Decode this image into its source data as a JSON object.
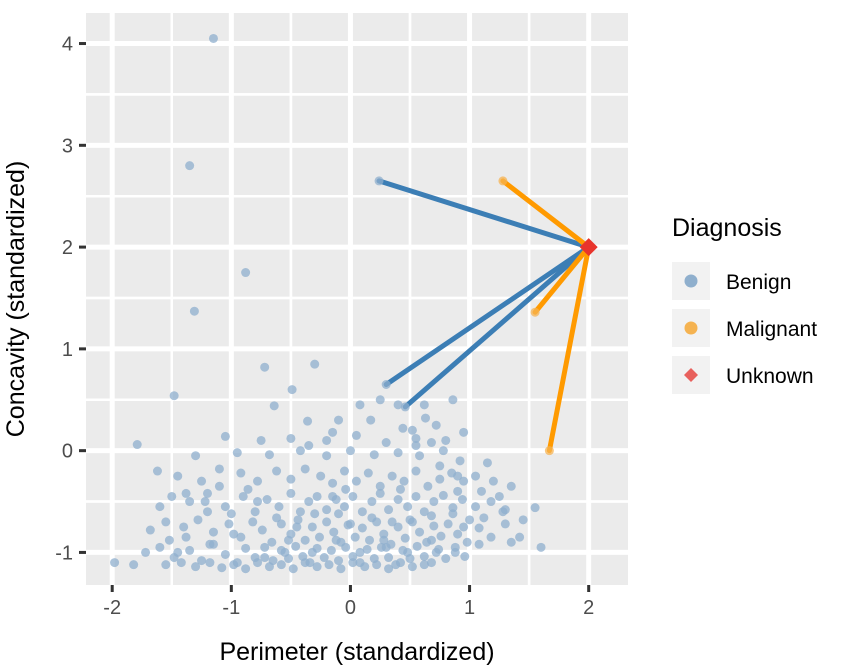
{
  "chart_data": {
    "type": "scatter",
    "title": "",
    "xlabel": "Perimeter (standardized)",
    "ylabel": "Concavity (standardized)",
    "xlim": [
      -2.22,
      2.33
    ],
    "ylim": [
      -1.32,
      4.3
    ],
    "xticks": [
      -2,
      -1,
      0,
      1,
      2
    ],
    "xticklabels": [
      "-2",
      "-1",
      "0",
      "1",
      "2"
    ],
    "yticks": [
      -1,
      0,
      1,
      2,
      3,
      4
    ],
    "yticklabels": [
      "-1",
      "0",
      "1",
      "2",
      "3",
      "4"
    ],
    "grid": true,
    "panel_background": "#EBEBEB",
    "grid_major_color": "#FFFFFF",
    "grid_minor_color": "#FFFFFF",
    "legend": {
      "title": "Diagnosis",
      "position": "right",
      "entries": [
        {
          "label": "Benign",
          "color": "#8FAFCD",
          "shape": "circle"
        },
        {
          "label": "Malignant",
          "color": "#F5B351",
          "shape": "circle"
        },
        {
          "label": "Unknown",
          "color": "#E8615D",
          "shape": "diamond"
        }
      ]
    },
    "series": [
      {
        "name": "Benign",
        "color": "#8FAFCD",
        "shape": "circle",
        "point_size": 9,
        "opacity": 0.75,
        "points": [
          [
            -1.15,
            4.05
          ],
          [
            -1.35,
            2.8
          ],
          [
            0.24,
            2.65
          ],
          [
            -0.88,
            1.75
          ],
          [
            -1.31,
            1.37
          ],
          [
            -0.3,
            0.85
          ],
          [
            -0.72,
            0.82
          ],
          [
            0.3,
            0.65
          ],
          [
            -1.48,
            0.54
          ],
          [
            -0.49,
            0.6
          ],
          [
            -0.64,
            0.44
          ],
          [
            0.46,
            0.43
          ],
          [
            0.62,
            0.45
          ],
          [
            0.86,
            0.5
          ],
          [
            0.63,
            0.32
          ],
          [
            -0.36,
            0.29
          ],
          [
            -0.1,
            0.3
          ],
          [
            0.17,
            0.3
          ],
          [
            0.44,
            0.22
          ],
          [
            0.72,
            0.25
          ],
          [
            -1.79,
            0.06
          ],
          [
            -1.05,
            0.14
          ],
          [
            -0.75,
            0.1
          ],
          [
            -0.5,
            0.12
          ],
          [
            -0.2,
            0.1
          ],
          [
            0.05,
            0.15
          ],
          [
            0.3,
            0.08
          ],
          [
            0.55,
            0.12
          ],
          [
            0.8,
            0.1
          ],
          [
            0.95,
            0.18
          ],
          [
            -1.3,
            -0.05
          ],
          [
            -0.95,
            -0.02
          ],
          [
            -0.68,
            -0.04
          ],
          [
            -0.42,
            0.0
          ],
          [
            -0.2,
            -0.05
          ],
          [
            0.0,
            0.0
          ],
          [
            0.2,
            -0.04
          ],
          [
            0.4,
            -0.02
          ],
          [
            0.58,
            -0.05
          ],
          [
            0.78,
            0.0
          ],
          [
            0.92,
            -0.1
          ],
          [
            1.15,
            -0.12
          ],
          [
            -1.62,
            -0.2
          ],
          [
            -1.45,
            -0.25
          ],
          [
            -1.25,
            -0.3
          ],
          [
            -1.1,
            -0.18
          ],
          [
            -0.92,
            -0.22
          ],
          [
            -0.78,
            -0.3
          ],
          [
            -0.62,
            -0.2
          ],
          [
            -0.5,
            -0.28
          ],
          [
            -0.38,
            -0.18
          ],
          [
            -0.25,
            -0.25
          ],
          [
            -0.15,
            -0.32
          ],
          [
            -0.05,
            -0.2
          ],
          [
            0.05,
            -0.3
          ],
          [
            0.15,
            -0.22
          ],
          [
            0.25,
            -0.35
          ],
          [
            0.35,
            -0.25
          ],
          [
            0.45,
            -0.3
          ],
          [
            0.55,
            -0.2
          ],
          [
            0.65,
            -0.35
          ],
          [
            0.75,
            -0.28
          ],
          [
            0.85,
            -0.22
          ],
          [
            0.95,
            -0.3
          ],
          [
            1.05,
            -0.25
          ],
          [
            1.2,
            -0.3
          ],
          [
            1.35,
            -0.35
          ],
          [
            -1.5,
            -0.45
          ],
          [
            -1.35,
            -0.5
          ],
          [
            -1.2,
            -0.42
          ],
          [
            -1.05,
            -0.55
          ],
          [
            -0.9,
            -0.45
          ],
          [
            -0.8,
            -0.6
          ],
          [
            -0.7,
            -0.48
          ],
          [
            -0.6,
            -0.55
          ],
          [
            -0.5,
            -0.42
          ],
          [
            -0.42,
            -0.6
          ],
          [
            -0.35,
            -0.5
          ],
          [
            -0.28,
            -0.45
          ],
          [
            -0.2,
            -0.58
          ],
          [
            -0.12,
            -0.48
          ],
          [
            -0.05,
            -0.55
          ],
          [
            0.02,
            -0.45
          ],
          [
            0.1,
            -0.6
          ],
          [
            0.18,
            -0.5
          ],
          [
            0.25,
            -0.42
          ],
          [
            0.32,
            -0.58
          ],
          [
            0.4,
            -0.48
          ],
          [
            0.48,
            -0.55
          ],
          [
            0.55,
            -0.45
          ],
          [
            0.62,
            -0.6
          ],
          [
            0.7,
            -0.5
          ],
          [
            0.78,
            -0.44
          ],
          [
            0.86,
            -0.56
          ],
          [
            0.94,
            -0.48
          ],
          [
            1.05,
            -0.55
          ],
          [
            1.18,
            -0.5
          ],
          [
            1.3,
            -0.58
          ],
          [
            1.55,
            -0.56
          ],
          [
            -1.55,
            -0.7
          ],
          [
            -1.4,
            -0.75
          ],
          [
            -1.28,
            -0.68
          ],
          [
            -1.15,
            -0.8
          ],
          [
            -1.02,
            -0.72
          ],
          [
            -0.92,
            -0.85
          ],
          [
            -0.82,
            -0.7
          ],
          [
            -0.74,
            -0.78
          ],
          [
            -0.66,
            -0.9
          ],
          [
            -0.58,
            -0.72
          ],
          [
            -0.5,
            -0.82
          ],
          [
            -0.44,
            -0.68
          ],
          [
            -0.38,
            -0.88
          ],
          [
            -0.32,
            -0.75
          ],
          [
            -0.26,
            -0.85
          ],
          [
            -0.2,
            -0.7
          ],
          [
            -0.14,
            -0.8
          ],
          [
            -0.08,
            -0.9
          ],
          [
            -0.02,
            -0.73
          ],
          [
            0.04,
            -0.85
          ],
          [
            0.1,
            -0.76
          ],
          [
            0.16,
            -0.88
          ],
          [
            0.22,
            -0.7
          ],
          [
            0.28,
            -0.82
          ],
          [
            0.34,
            -0.92
          ],
          [
            0.4,
            -0.75
          ],
          [
            0.46,
            -0.86
          ],
          [
            0.52,
            -0.7
          ],
          [
            0.58,
            -0.8
          ],
          [
            0.64,
            -0.9
          ],
          [
            0.7,
            -0.74
          ],
          [
            0.76,
            -0.84
          ],
          [
            0.82,
            -0.72
          ],
          [
            0.9,
            -0.82
          ],
          [
            0.98,
            -0.9
          ],
          [
            1.08,
            -0.76
          ],
          [
            1.18,
            -0.85
          ],
          [
            1.3,
            -0.72
          ],
          [
            -1.72,
            -1.0
          ],
          [
            -1.6,
            -0.95
          ],
          [
            -1.48,
            -1.05
          ],
          [
            -1.35,
            -0.98
          ],
          [
            -1.25,
            -1.08
          ],
          [
            -1.15,
            -0.92
          ],
          [
            -1.05,
            -1.02
          ],
          [
            -0.95,
            -1.1
          ],
          [
            -0.88,
            -0.96
          ],
          [
            -0.8,
            -1.05
          ],
          [
            -0.72,
            -0.95
          ],
          [
            -0.65,
            -1.08
          ],
          [
            -0.58,
            -0.98
          ],
          [
            -0.52,
            -1.06
          ],
          [
            -0.46,
            -0.94
          ],
          [
            -0.4,
            -1.04
          ],
          [
            -0.34,
            -1.1
          ],
          [
            -0.28,
            -0.96
          ],
          [
            -0.22,
            -1.05
          ],
          [
            -0.16,
            -0.98
          ],
          [
            -0.1,
            -1.08
          ],
          [
            -0.04,
            -0.95
          ],
          [
            0.02,
            -1.04
          ],
          [
            0.08,
            -1.1
          ],
          [
            0.14,
            -0.97
          ],
          [
            0.2,
            -1.06
          ],
          [
            0.26,
            -0.95
          ],
          [
            0.32,
            -1.05
          ],
          [
            0.38,
            -1.12
          ],
          [
            0.44,
            -0.98
          ],
          [
            0.5,
            -1.06
          ],
          [
            0.56,
            -0.94
          ],
          [
            0.62,
            -1.04
          ],
          [
            0.68,
            -1.1
          ],
          [
            0.74,
            -0.97
          ],
          [
            0.8,
            -1.06
          ],
          [
            0.88,
            -0.95
          ],
          [
            0.96,
            -1.04
          ],
          [
            -1.98,
            -1.1
          ],
          [
            -1.82,
            -1.12
          ],
          [
            -1.55,
            -1.12
          ],
          [
            -1.42,
            -1.1
          ],
          [
            -1.3,
            -1.14
          ],
          [
            -1.18,
            -1.1
          ],
          [
            -1.08,
            -1.15
          ],
          [
            -0.98,
            -1.12
          ],
          [
            -0.88,
            -1.16
          ],
          [
            -0.78,
            -1.1
          ],
          [
            -0.68,
            -1.14
          ],
          [
            -0.58,
            -1.12
          ],
          [
            -0.48,
            -1.16
          ],
          [
            -0.38,
            -1.1
          ],
          [
            -0.28,
            -1.14
          ],
          [
            -0.18,
            -1.12
          ],
          [
            -0.08,
            -1.16
          ],
          [
            0.02,
            -1.1
          ],
          [
            0.12,
            -1.14
          ],
          [
            0.22,
            -1.12
          ],
          [
            0.32,
            -1.16
          ],
          [
            0.42,
            -1.1
          ],
          [
            0.52,
            -1.14
          ],
          [
            0.62,
            -1.12
          ],
          [
            -1.1,
            -0.35
          ],
          [
            -1.0,
            -0.62
          ],
          [
            -0.86,
            -0.38
          ],
          [
            -0.62,
            -0.66
          ],
          [
            -0.3,
            -0.62
          ],
          [
            -0.04,
            -0.38
          ],
          [
            0.18,
            -0.66
          ],
          [
            0.42,
            -0.38
          ],
          [
            0.68,
            -0.64
          ],
          [
            0.9,
            -0.4
          ],
          [
            1.12,
            -0.66
          ],
          [
            1.35,
            -0.9
          ],
          [
            -1.38,
            -0.85
          ],
          [
            -1.2,
            -0.6
          ],
          [
            -0.55,
            -1.0
          ],
          [
            -0.1,
            -0.62
          ],
          [
            0.3,
            -0.95
          ],
          [
            0.72,
            -1.0
          ],
          [
            1.0,
            -0.68
          ],
          [
            -0.45,
            -0.75
          ],
          [
            0.0,
            -0.72
          ],
          [
            0.5,
            -0.68
          ],
          [
            0.95,
            -0.75
          ],
          [
            -0.78,
            -0.5
          ],
          [
            -0.15,
            -0.45
          ],
          [
            0.35,
            -0.7
          ],
          [
            0.86,
            -0.62
          ],
          [
            1.25,
            -0.45
          ],
          [
            1.45,
            -0.68
          ],
          [
            -1.6,
            -0.55
          ],
          [
            -1.45,
            -1.0
          ],
          [
            -1.18,
            -0.92
          ],
          [
            -0.98,
            -0.82
          ],
          [
            -0.72,
            -1.05
          ],
          [
            -0.52,
            -0.88
          ],
          [
            -0.32,
            -1.0
          ],
          [
            -0.12,
            -0.88
          ],
          [
            0.08,
            -1.0
          ],
          [
            0.28,
            -0.88
          ],
          [
            0.48,
            -1.0
          ],
          [
            0.68,
            -0.88
          ],
          [
            0.88,
            -1.0
          ],
          [
            1.08,
            -0.92
          ],
          [
            0.55,
            0.05
          ],
          [
            0.68,
            0.08
          ],
          [
            0.4,
            0.45
          ],
          [
            0.52,
            0.2
          ],
          [
            0.25,
            0.5
          ],
          [
            0.08,
            0.45
          ],
          [
            -0.15,
            0.18
          ],
          [
            -0.35,
            0.05
          ],
          [
            0.75,
            -0.15
          ],
          [
            0.9,
            -0.25
          ],
          [
            1.1,
            -0.4
          ],
          [
            1.28,
            -0.6
          ],
          [
            1.42,
            -0.85
          ],
          [
            1.6,
            -0.95
          ],
          [
            -1.68,
            -0.78
          ],
          [
            -1.52,
            -0.88
          ],
          [
            -1.38,
            -0.42
          ],
          [
            -1.22,
            -0.5
          ]
        ]
      },
      {
        "name": "Malignant",
        "color": "#F5B351",
        "shape": "circle",
        "point_size": 9,
        "opacity": 0.75,
        "points": [
          [
            1.28,
            2.65
          ],
          [
            1.55,
            1.36
          ],
          [
            1.67,
            0.0
          ]
        ]
      },
      {
        "name": "Unknown",
        "color": "#E8342C",
        "shape": "diamond",
        "point_size": 14,
        "opacity": 1,
        "points": [
          [
            2.0,
            2.0
          ]
        ]
      }
    ],
    "connector_lines": [
      {
        "from": [
          2.0,
          2.0
        ],
        "to": [
          0.24,
          2.65
        ],
        "color": "#3C7EB5",
        "width": 5,
        "neighbor_class": "Benign"
      },
      {
        "from": [
          2.0,
          2.0
        ],
        "to": [
          0.3,
          0.65
        ],
        "color": "#3C7EB5",
        "width": 5,
        "neighbor_class": "Benign"
      },
      {
        "from": [
          2.0,
          2.0
        ],
        "to": [
          0.46,
          0.43
        ],
        "color": "#3C7EB5",
        "width": 5,
        "neighbor_class": "Benign"
      },
      {
        "from": [
          2.0,
          2.0
        ],
        "to": [
          1.28,
          2.65
        ],
        "color": "#FF9A00",
        "width": 5,
        "neighbor_class": "Malignant"
      },
      {
        "from": [
          2.0,
          2.0
        ],
        "to": [
          1.55,
          1.36
        ],
        "color": "#FF9A00",
        "width": 5,
        "neighbor_class": "Malignant"
      },
      {
        "from": [
          2.0,
          2.0
        ],
        "to": [
          1.67,
          0.0
        ],
        "color": "#FF9A00",
        "width": 5,
        "neighbor_class": "Malignant"
      }
    ]
  }
}
